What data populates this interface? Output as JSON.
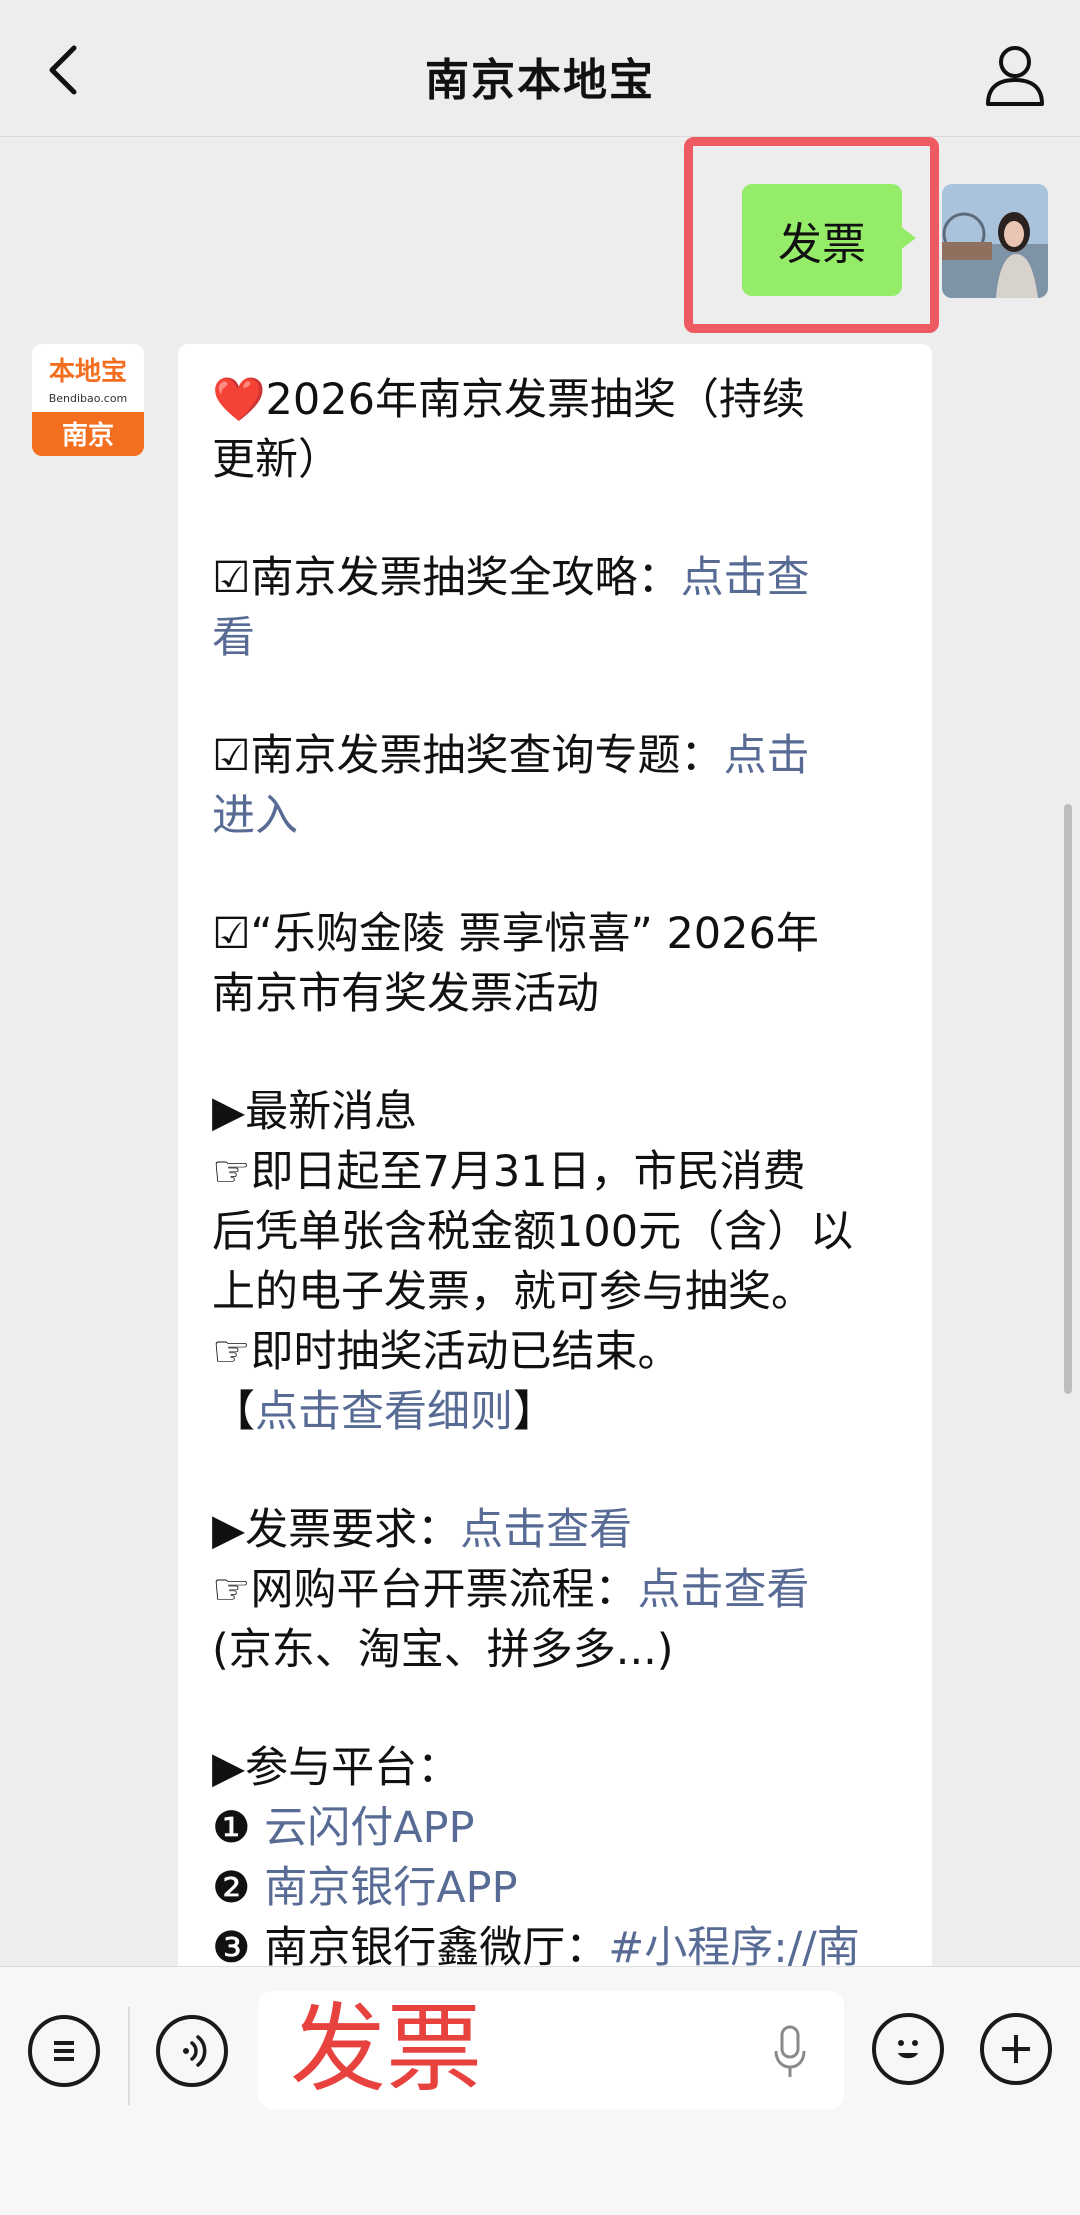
{
  "header": {
    "title": "南京本地宝"
  },
  "chat": {
    "user_message": "发票",
    "brand_avatar": {
      "logo_text": "本地宝",
      "domain_text": "Bendibao.com",
      "city_text": "南京"
    },
    "reply_lines": {
      "l1a": "❤️",
      "l1b": "2026年南京发票抽奖（持续",
      "l2": "更新）",
      "l3a": "☑南京发票抽奖全攻略：",
      "l3b": "点击查",
      "l4": "看",
      "l5a": "☑南京发票抽奖查询专题：",
      "l5b": "点击",
      "l6": "进入",
      "l7": "☑“乐购金陵 票享惊喜” 2026年",
      "l8": "南京市有奖发票活动",
      "l9": "▶最新消息",
      "l10": "☞即日起至7月31日，市民消费",
      "l11": "后凭单张含税金额100元（含）以",
      "l12": "上的电子发票，就可参与抽奖。",
      "l13": "☞即时抽奖活动已结束。",
      "l14a": "【",
      "l14b": "点击查看细则",
      "l14c": "】",
      "l15a": "▶发票要求：",
      "l15b": "点击查看",
      "l16a": "☞网购平台开票流程：",
      "l16b": "点击查看",
      "l17": "(京东、淘宝、拼多多...)",
      "l18": "▶参与平台：",
      "l19a": "❶ ",
      "l19b": "云闪付APP",
      "l20a": "❷ ",
      "l20b": "南京银行APP",
      "l21a": "❸ 南京银行鑫微厅：",
      "l21b": "#小程序://南"
    }
  },
  "input_bar": {
    "text": "发票"
  },
  "colors": {
    "link": "#576b95",
    "bubble_green": "#95ec69",
    "highlight": "#ee5a62",
    "input_text": "#e8423f"
  }
}
